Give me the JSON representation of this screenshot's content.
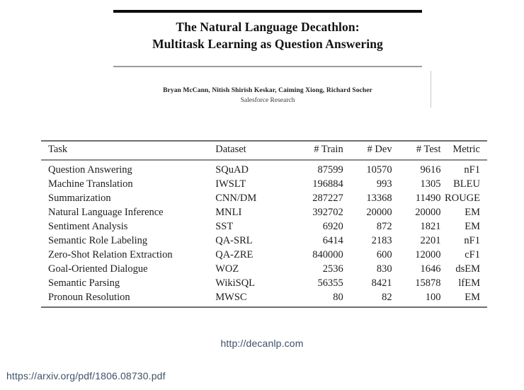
{
  "paper": {
    "title_line1": "The Natural Language Decathlon:",
    "title_line2": "Multitask Learning as Question Answering",
    "authors": "Bryan McCann, Nitish Shirish Keskar, Caiming Xiong, Richard Socher",
    "affiliation": "Salesforce Research"
  },
  "table": {
    "headers": {
      "task": "Task",
      "dataset": "Dataset",
      "train": "# Train",
      "dev": "# Dev",
      "test": "# Test",
      "metric": "Metric"
    },
    "rows": [
      {
        "task": "Question Answering",
        "dataset": "SQuAD",
        "train": "87599",
        "dev": "10570",
        "test": "9616",
        "metric": "nF1"
      },
      {
        "task": "Machine Translation",
        "dataset": "IWSLT",
        "train": "196884",
        "dev": "993",
        "test": "1305",
        "metric": "BLEU"
      },
      {
        "task": "Summarization",
        "dataset": "CNN/DM",
        "train": "287227",
        "dev": "13368",
        "test": "11490",
        "metric": "ROUGE"
      },
      {
        "task": "Natural Language Inference",
        "dataset": "MNLI",
        "train": "392702",
        "dev": "20000",
        "test": "20000",
        "metric": "EM"
      },
      {
        "task": "Sentiment Analysis",
        "dataset": "SST",
        "train": "6920",
        "dev": "872",
        "test": "1821",
        "metric": "EM"
      },
      {
        "task": "Semantic Role Labeling",
        "dataset": "QA-SRL",
        "train": "6414",
        "dev": "2183",
        "test": "2201",
        "metric": "nF1"
      },
      {
        "task": "Zero-Shot Relation Extraction",
        "dataset": "QA-ZRE",
        "train": "840000",
        "dev": "600",
        "test": "12000",
        "metric": "cF1"
      },
      {
        "task": "Goal-Oriented Dialogue",
        "dataset": "WOZ",
        "train": "2536",
        "dev": "830",
        "test": "1646",
        "metric": "dsEM"
      },
      {
        "task": "Semantic Parsing",
        "dataset": "WikiSQL",
        "train": "56355",
        "dev": "8421",
        "test": "15878",
        "metric": "lfEM"
      },
      {
        "task": "Pronoun Resolution",
        "dataset": "MWSC",
        "train": "80",
        "dev": "82",
        "test": "100",
        "metric": "EM"
      }
    ]
  },
  "links": {
    "project": "http://decanlp.com",
    "arxiv": "https://arxiv.org/pdf/1806.08730.pdf",
    "color": "#3d5269"
  }
}
